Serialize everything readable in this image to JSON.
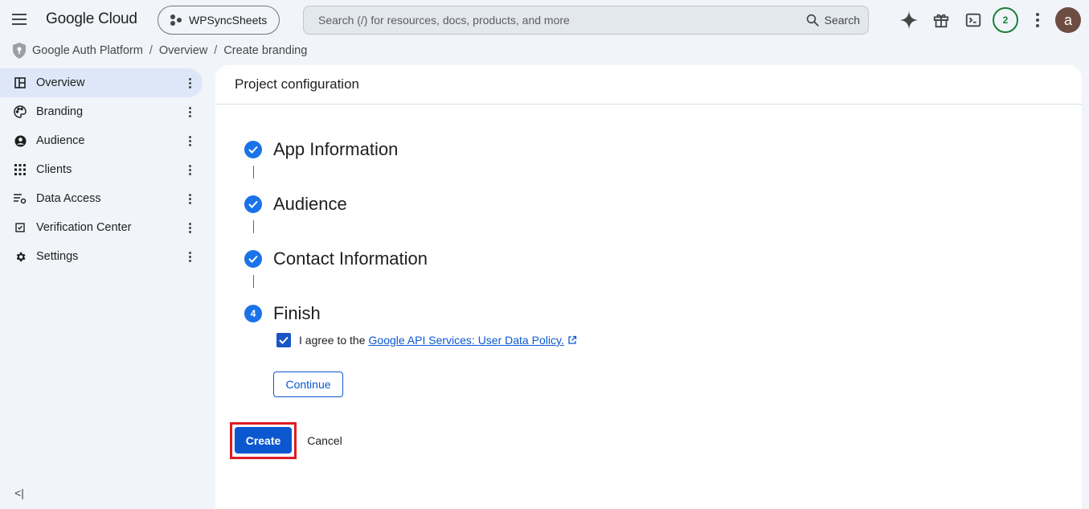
{
  "app": {
    "logo": "Google Cloud",
    "project": "WPSyncSheets"
  },
  "search": {
    "placeholder": "Search (/) for resources, docs, products, and more",
    "button_label": "Search"
  },
  "header_icons": [
    "gemini-sparkle-icon",
    "gift-icon",
    "cloud-shell-terminal-icon",
    "notifications-badge",
    "more-vert-icon"
  ],
  "notifications": {
    "count": "2"
  },
  "account": {
    "initial": "a",
    "color": "#6d4c41"
  },
  "breadcrumb": {
    "root": "Google Auth Platform",
    "items": [
      "Overview",
      "Create branding"
    ]
  },
  "sidebar": {
    "items": [
      {
        "label": "Overview",
        "icon": "dashboard-icon",
        "active": true
      },
      {
        "label": "Branding",
        "icon": "palette-icon",
        "active": false
      },
      {
        "label": "Audience",
        "icon": "account-circle-icon",
        "active": false
      },
      {
        "label": "Clients",
        "icon": "apps-grid-icon",
        "active": false
      },
      {
        "label": "Data Access",
        "icon": "data-access-icon",
        "active": false
      },
      {
        "label": "Verification Center",
        "icon": "verification-icon",
        "active": false
      },
      {
        "label": "Settings",
        "icon": "gear-icon",
        "active": false
      }
    ],
    "collapse_label": "<|"
  },
  "panel": {
    "title": "Project configuration"
  },
  "steps": [
    {
      "label": "App Information",
      "status": "done"
    },
    {
      "label": "Audience",
      "status": "done"
    },
    {
      "label": "Contact Information",
      "status": "done"
    },
    {
      "label": "Finish",
      "status": "current",
      "number": "4"
    }
  ],
  "agreement": {
    "checked": true,
    "prefix": "I agree to the",
    "link": "Google API Services: User Data Policy."
  },
  "buttons": {
    "continue": "Continue",
    "create": "Create",
    "cancel": "Cancel"
  },
  "colors": {
    "accent": "#0b57d0",
    "step_blue": "#1a73e8",
    "highlight": "#e01b24",
    "active_nav": "#dde7f7"
  }
}
